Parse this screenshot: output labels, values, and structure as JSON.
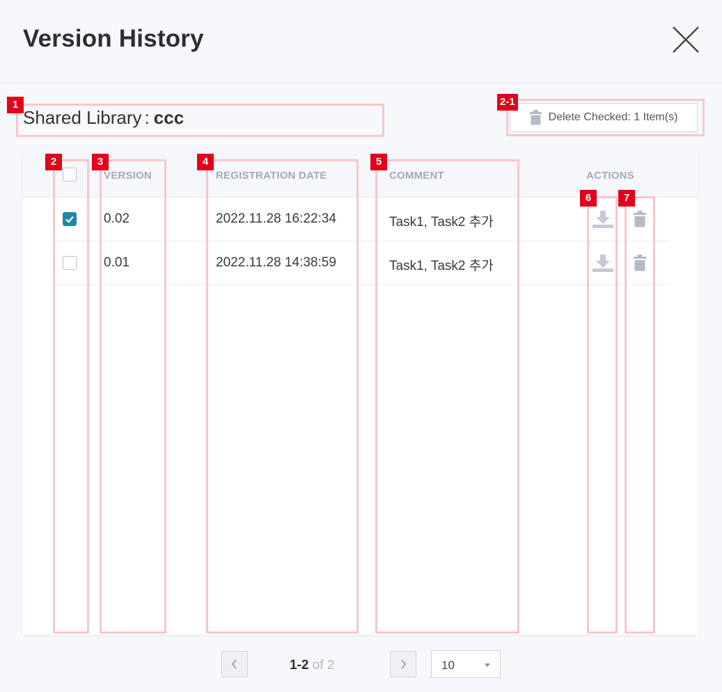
{
  "header": {
    "title": "Version History"
  },
  "library": {
    "label": "Shared Library",
    "separator": ":",
    "name": "ccc"
  },
  "toolbar": {
    "delete_checked_label": "Delete Checked: 1 Item(s)"
  },
  "table": {
    "columns": {
      "version": "VERSION",
      "registration_date": "REGISTRATION DATE",
      "comment": "COMMENT",
      "actions": "ACTIONS"
    },
    "header_checkbox_checked": false,
    "rows": [
      {
        "checked": true,
        "version": "0.02",
        "registration_date": "2022.11.28 16:22:34",
        "comment": "Task1, Task2 추가"
      },
      {
        "checked": false,
        "version": "0.01",
        "registration_date": "2022.11.28 14:38:59",
        "comment": "Task1, Task2 추가"
      }
    ]
  },
  "pagination": {
    "range": "1-2",
    "of": "of",
    "total": "2",
    "page_size": "10"
  },
  "annotations": {
    "tags": [
      "1",
      "2-1",
      "2",
      "3",
      "4",
      "5",
      "6",
      "7"
    ]
  },
  "colors": {
    "accent": "#1a8aa3",
    "annotation_tag": "#e2001a",
    "annotation_box": "#f7c7c9",
    "header_text": "#a3aabd"
  },
  "icons": {
    "close": "close-icon",
    "trash": "trash-icon",
    "download": "download-icon",
    "check": "check-icon",
    "prev": "chevron-left-icon",
    "next": "chevron-right-icon",
    "dropdown": "caret-down-icon"
  }
}
